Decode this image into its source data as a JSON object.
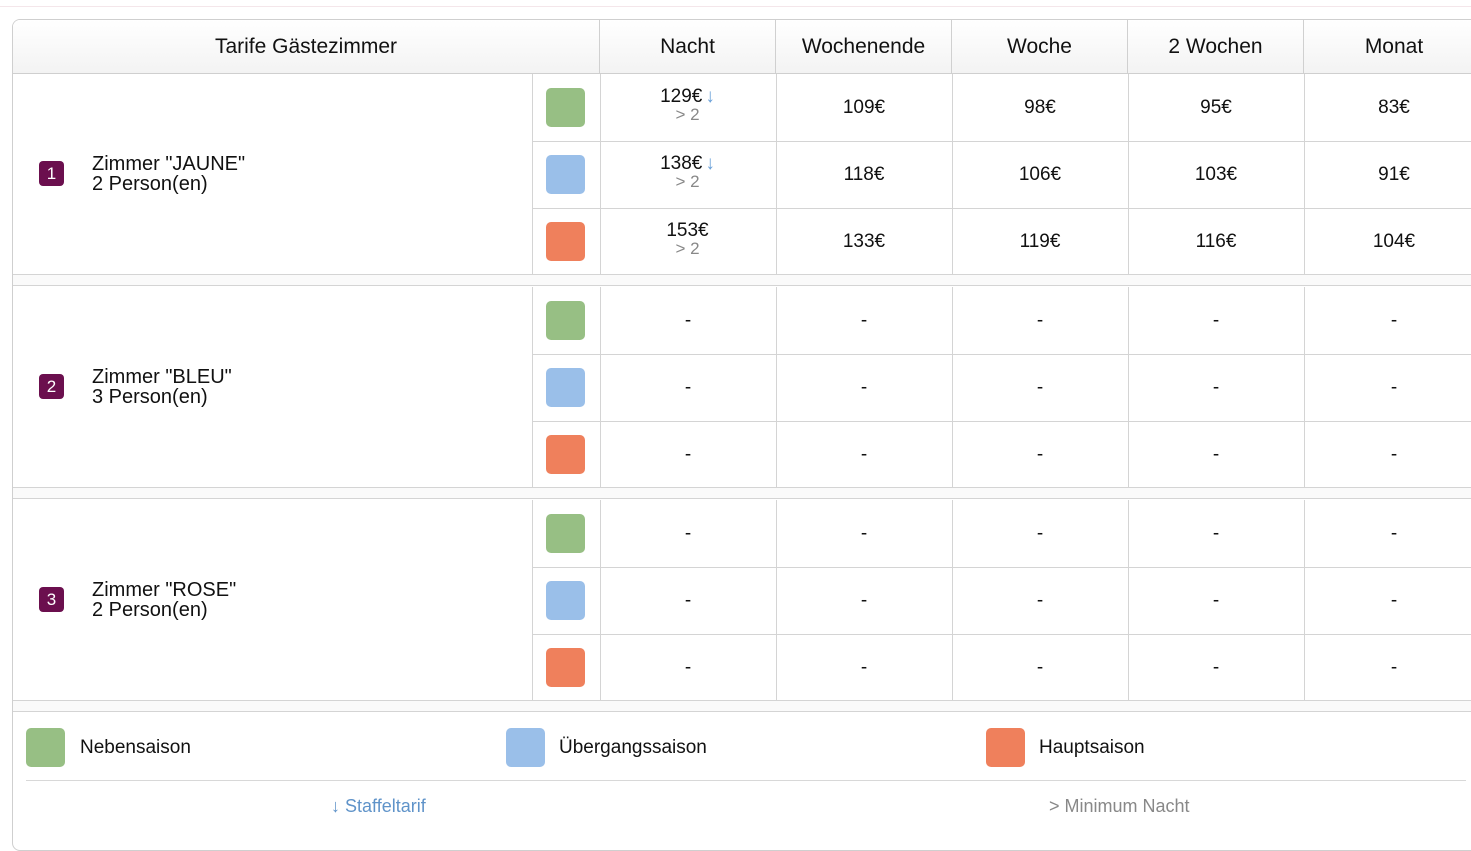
{
  "headers": {
    "title": "Tarife Gästezimmer",
    "night": "Nacht",
    "weekend": "Wochenende",
    "week": "Woche",
    "two_weeks": "2 Wochen",
    "month": "Monat"
  },
  "colors": {
    "low": "#97bf84",
    "mid": "#9abfe9",
    "high": "#ef805c",
    "badge": "#6b0f4e"
  },
  "rooms": [
    {
      "number": "1",
      "name": "Zimmer \"JAUNE\"",
      "persons": "2 Person(en)",
      "rows": [
        {
          "night": "129€",
          "arrow": "↓",
          "min": "> 2",
          "weekend": "109€",
          "week": "98€",
          "two_weeks": "95€",
          "month": "83€"
        },
        {
          "night": "138€",
          "arrow": "↓",
          "min": "> 2",
          "weekend": "118€",
          "week": "106€",
          "two_weeks": "103€",
          "month": "91€"
        },
        {
          "night": "153€",
          "arrow": "",
          "min": "> 2",
          "weekend": "133€",
          "week": "119€",
          "two_weeks": "116€",
          "month": "104€"
        }
      ]
    },
    {
      "number": "2",
      "name": "Zimmer \"BLEU\"",
      "persons": "3 Person(en)",
      "rows": [
        {
          "night": "-",
          "weekend": "-",
          "week": "-",
          "two_weeks": "-",
          "month": "-"
        },
        {
          "night": "-",
          "weekend": "-",
          "week": "-",
          "two_weeks": "-",
          "month": "-"
        },
        {
          "night": "-",
          "weekend": "-",
          "week": "-",
          "two_weeks": "-",
          "month": "-"
        }
      ]
    },
    {
      "number": "3",
      "name": "Zimmer \"ROSE\"",
      "persons": "2 Person(en)",
      "rows": [
        {
          "night": "-",
          "weekend": "-",
          "week": "-",
          "two_weeks": "-",
          "month": "-"
        },
        {
          "night": "-",
          "weekend": "-",
          "week": "-",
          "two_weeks": "-",
          "month": "-"
        },
        {
          "night": "-",
          "weekend": "-",
          "week": "-",
          "two_weeks": "-",
          "month": "-"
        }
      ]
    }
  ],
  "legend": {
    "low": "Nebensaison",
    "mid": "Übergangssaison",
    "high": "Hauptsaison",
    "tiered": "↓ Staffeltarif",
    "min_nights": "> Minimum Nacht"
  }
}
